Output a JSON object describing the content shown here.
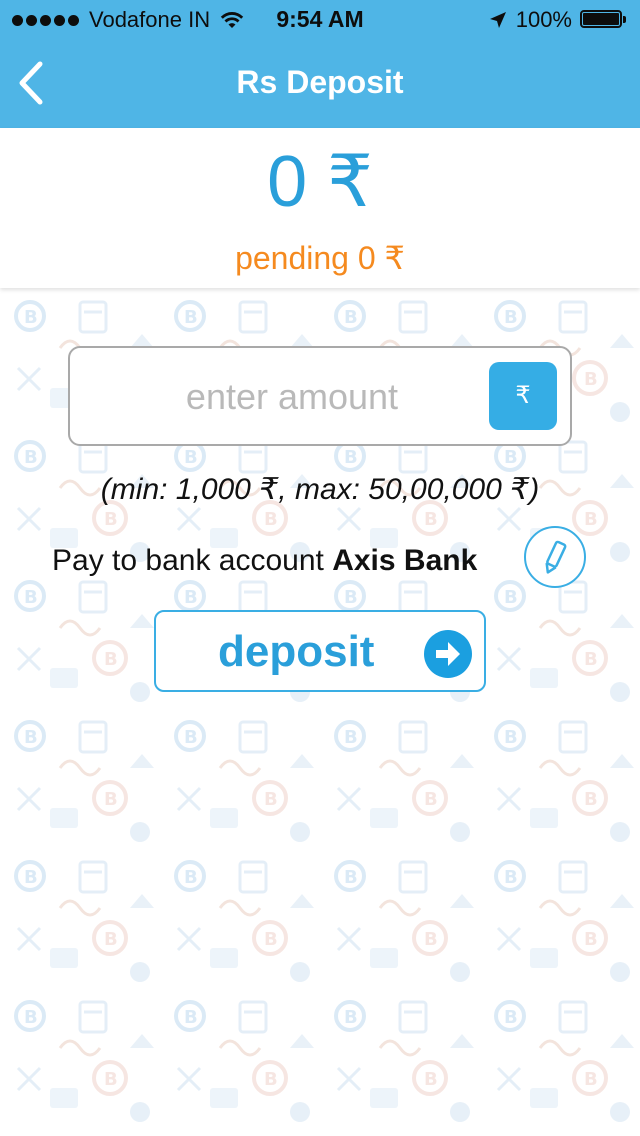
{
  "status_bar": {
    "carrier": "Vodafone IN",
    "time": "9:54 AM",
    "battery": "100%",
    "signal_bars": 5
  },
  "nav": {
    "title": "Rs Deposit",
    "back_icon": "chevron-left-icon"
  },
  "balance": {
    "amount": "0 ₹",
    "pending": "pending 0 ₹"
  },
  "amount_input": {
    "placeholder": "enter amount",
    "value": "",
    "currency_symbol": "₹"
  },
  "limits": "(min: 1,000 ₹, max: 50,00,000 ₹)",
  "bank": {
    "prefix": "Pay to bank account",
    "name": "Axis Bank",
    "edit_icon": "pencil-icon"
  },
  "deposit_button": {
    "label": "deposit",
    "icon": "arrow-right-circle-icon"
  },
  "colors": {
    "header": "#4fb5e6",
    "accent": "#2a9fda",
    "pending": "#f58a1f",
    "pattern": "#e8f3fb"
  }
}
